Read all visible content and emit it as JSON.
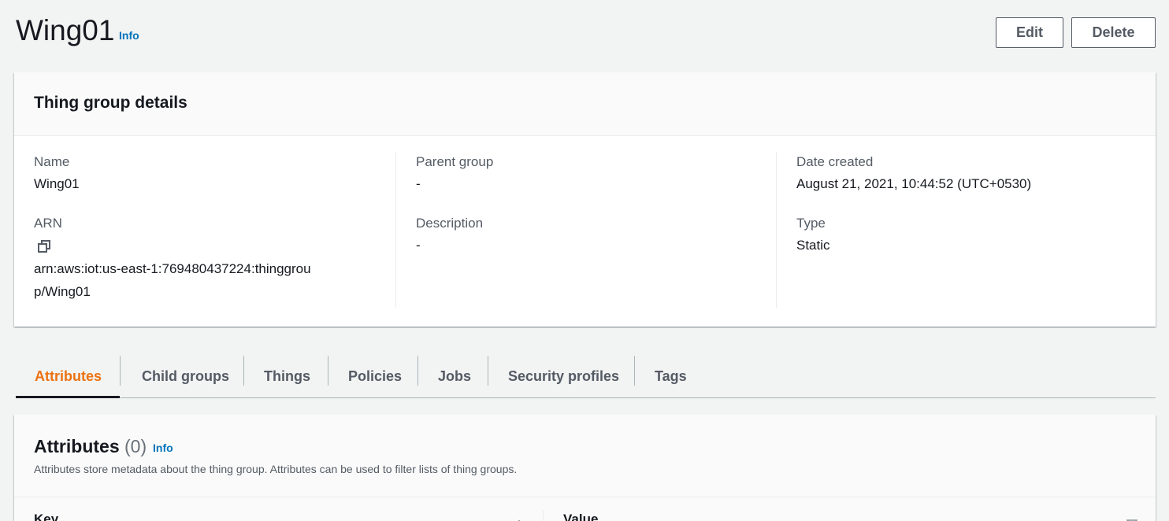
{
  "header": {
    "title": "Wing01",
    "info_label": "Info",
    "edit_label": "Edit",
    "delete_label": "Delete"
  },
  "details": {
    "panel_title": "Thing group details",
    "name_label": "Name",
    "name_value": "Wing01",
    "arn_label": "ARN",
    "arn_value": "arn:aws:iot:us-east-1:769480437224:thinggroup/Wing01",
    "parent_label": "Parent group",
    "parent_value": "-",
    "description_label": "Description",
    "description_value": "-",
    "date_label": "Date created",
    "date_value": "August 21, 2021, 10:44:52 (UTC+0530)",
    "type_label": "Type",
    "type_value": "Static",
    "copy_icon": "copy-icon"
  },
  "tabs": [
    {
      "label": "Attributes",
      "active": true
    },
    {
      "label": "Child groups"
    },
    {
      "label": "Things"
    },
    {
      "label": "Policies"
    },
    {
      "label": "Jobs"
    },
    {
      "label": "Security profiles"
    },
    {
      "label": "Tags"
    }
  ],
  "attributes": {
    "title": "Attributes",
    "count": "(0)",
    "info_label": "Info",
    "description": "Attributes store metadata about the thing group. Attributes can be used to filter lists of thing groups.",
    "columns": [
      "Key",
      "Value"
    ],
    "rows": []
  },
  "colors": {
    "accent": "#ec7211",
    "link": "#0073bb",
    "text": "#16191f",
    "muted": "#545b64",
    "background": "#f2f3f3"
  }
}
